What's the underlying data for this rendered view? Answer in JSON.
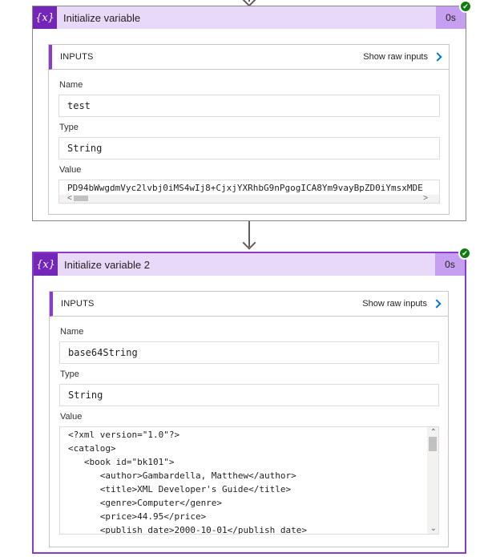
{
  "actions": [
    {
      "title": "Initialize variable",
      "duration": "0s",
      "icon": "variable-icon",
      "icon_text": "{x}",
      "inputs_label": "INPUTS",
      "show_raw_label": "Show raw inputs",
      "fields": {
        "name_label": "Name",
        "name_value": "test",
        "type_label": "Type",
        "type_value": "String",
        "value_label": "Value",
        "value_text": "PD94bWwgdmVyc2lvbj0iMS4wIj8+CjxjYXRhbG9nPgogICA8Ym9vayBpZD0iYmsxMDE"
      }
    },
    {
      "title": "Initialize variable 2",
      "duration": "0s",
      "icon": "variable-icon",
      "icon_text": "{x}",
      "inputs_label": "INPUTS",
      "show_raw_label": "Show raw inputs",
      "fields": {
        "name_label": "Name",
        "name_value": "base64String",
        "type_label": "Type",
        "type_value": "String",
        "value_label": "Value",
        "value_lines": [
          "<?xml version=\"1.0\"?>",
          "<catalog>",
          "   <book id=\"bk101\">",
          "      <author>Gambardella, Matthew</author>",
          "      <title>XML Developer's Guide</title>",
          "      <genre>Computer</genre>",
          "      <price>44.95</price>",
          "      <publish_date>2000-10-01</publish_date>"
        ]
      }
    }
  ],
  "colors": {
    "accent": "#8c3ac9",
    "header_bg": "#e9d9f8",
    "icon_bg": "#7326b7",
    "duration_bg": "#c69ff1",
    "success": "#107c10",
    "link_chevron": "#0078d4"
  }
}
